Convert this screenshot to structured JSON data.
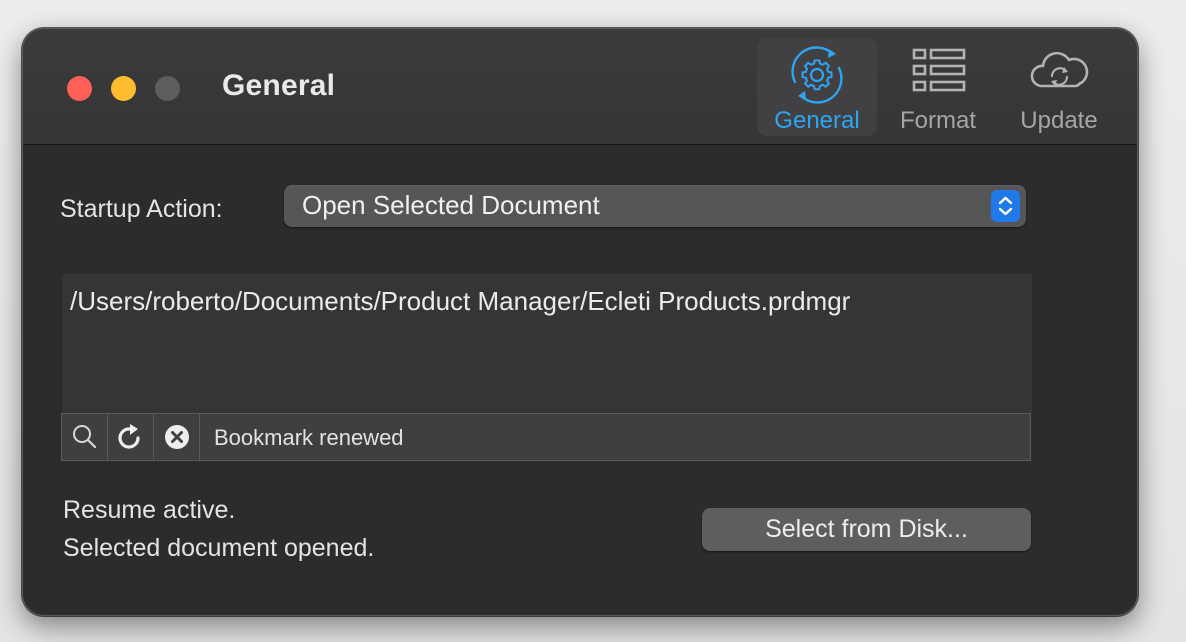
{
  "window": {
    "title": "General"
  },
  "toolbar": {
    "items": [
      {
        "label": "General",
        "icon": "gear-sync-icon",
        "selected": true
      },
      {
        "label": "Format",
        "icon": "list-icon",
        "selected": false
      },
      {
        "label": "Update",
        "icon": "cloud-sync-icon",
        "selected": false
      }
    ]
  },
  "startup": {
    "label": "Startup Action:",
    "selected_value": "Open Selected Document"
  },
  "document": {
    "path": "/Users/roberto/Documents/Product Manager/Ecleti Products.prdmgr",
    "bookmark_status": "Bookmark renewed"
  },
  "status": {
    "line1": "Resume active.",
    "line2": "Selected document opened."
  },
  "actions": {
    "select_from_disk": "Select from Disk..."
  },
  "colors": {
    "accent": "#2ea4f2",
    "popup_button": "#1f79e8",
    "close": "#fe5f57",
    "minimize": "#febc2e",
    "zoom_inactive": "#5e5e60",
    "window_bg": "#2c2c2d"
  }
}
